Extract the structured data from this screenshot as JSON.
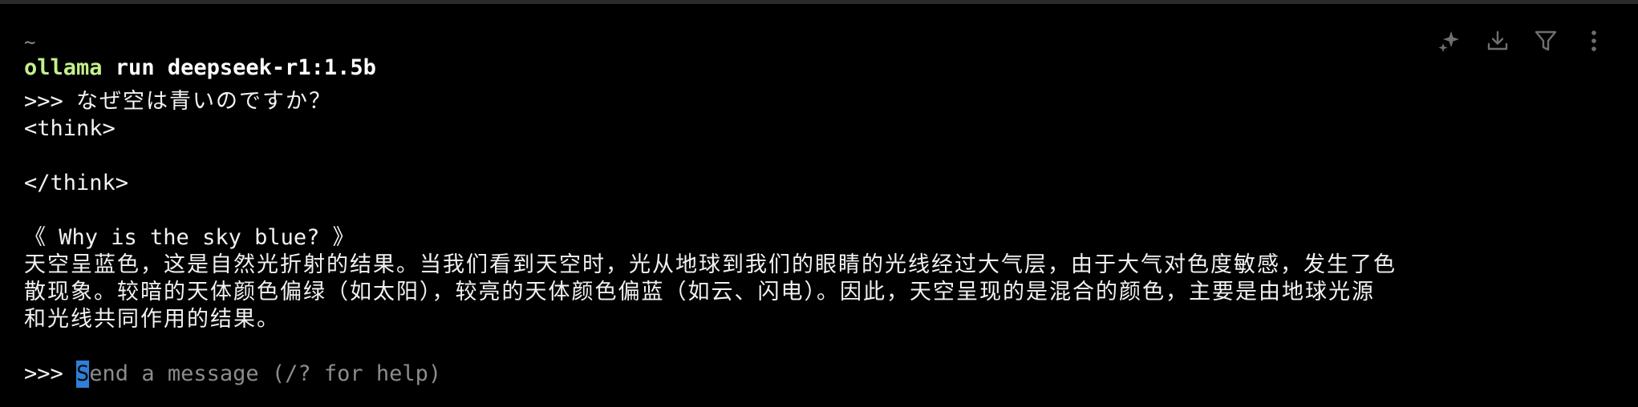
{
  "terminal": {
    "cwd": "~",
    "command": {
      "program": "ollama",
      "args": " run deepseek-r1:1.5b"
    },
    "prompt_symbol": ">>> ",
    "user_message": "なぜ空は青いのですか？",
    "think_open": "<think>",
    "think_close": "</think>",
    "response_title": "《 Why is the sky blue? 》",
    "response_lines": [
      "天空呈蓝色，这是自然光折射的结果。当我们看到天空时，光从地球到我们的眼睛的光线经过大气层，由于大气对色度敏感，发生了色",
      "散现象。较暗的天体颜色偏绿（如太阳），较亮的天体颜色偏蓝（如云、闪电）。因此，天空呈现的是混合的颜色，主要是由地球光源",
      "和光线共同作用的结果。"
    ],
    "input_cursor_char": "S",
    "input_placeholder_rest": "end a message (/? for help)"
  },
  "toolbar": {
    "icons": [
      "sparkle-icon",
      "download-icon",
      "filter-icon",
      "more-vertical-icon"
    ]
  },
  "colors": {
    "background": "#000000",
    "program": "#c3f08a",
    "cursor": "#2f7fd8",
    "placeholder": "#8c8c8c"
  }
}
